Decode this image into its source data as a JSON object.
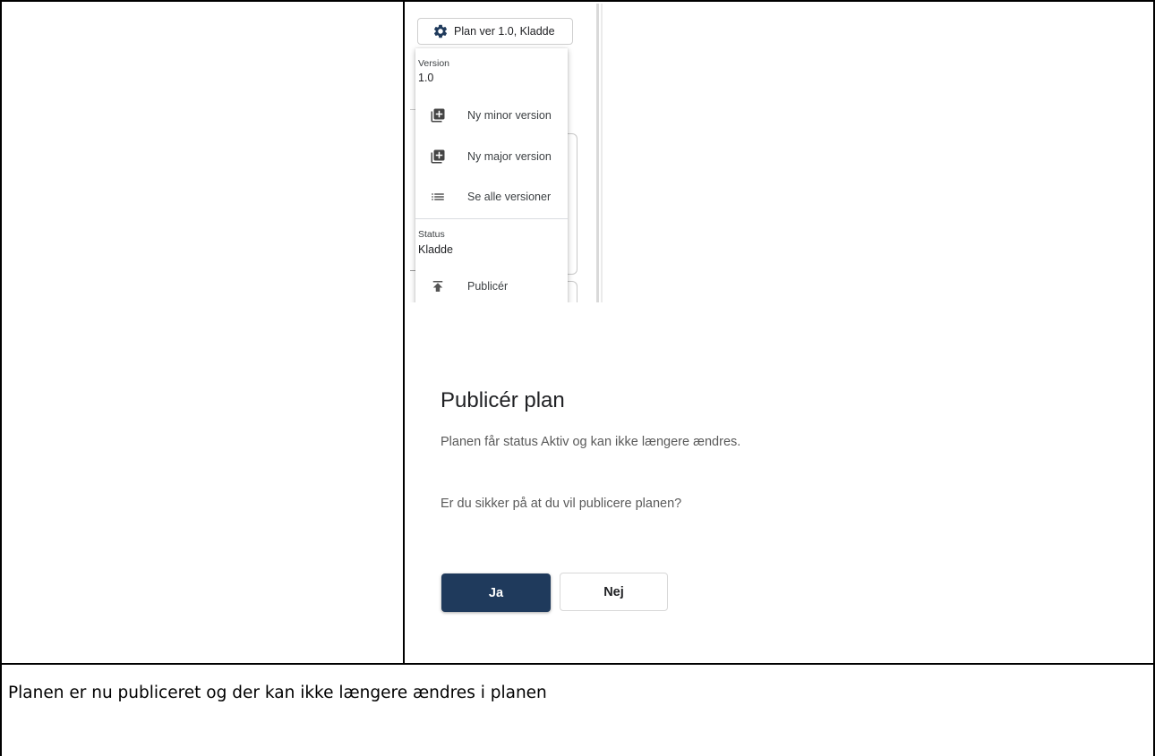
{
  "version_menu": {
    "button_label": "Plan ver 1.0, Kladde",
    "version_caption": "Version",
    "version_value": "1.0",
    "items": [
      {
        "label": "Ny minor version",
        "icon": "library-add-icon"
      },
      {
        "label": "Ny major version",
        "icon": "library-add-icon"
      },
      {
        "label": "Se alle versioner",
        "icon": "list-icon"
      }
    ],
    "status_caption": "Status",
    "status_value": "Kladde",
    "publish_label": "Publicér",
    "publish_icon": "publish-icon"
  },
  "publish_dialog": {
    "title": "Publicér plan",
    "message": "Planen får status Aktiv og kan ikke længere ændres.",
    "question": "Er du sikker på at du vil publicere planen?",
    "yes_label": "Ja",
    "no_label": "Nej",
    "yes_color": "#1f3a5c"
  },
  "document": {
    "note": "Planen er nu publiceret og der kan ikke længere ændres i planen"
  }
}
